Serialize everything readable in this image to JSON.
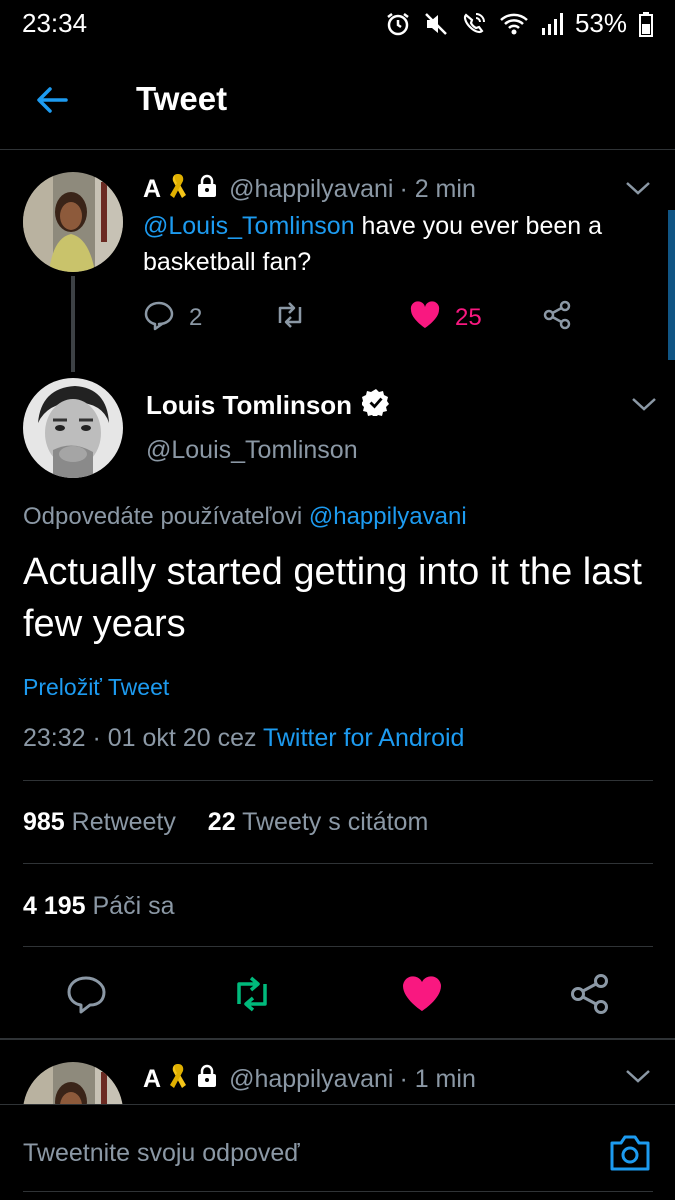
{
  "status_bar": {
    "time": "23:34",
    "battery": "53%",
    "icons": [
      "alarm-icon",
      "mute-icon",
      "wifi-call-icon",
      "wifi-icon",
      "signal-icon",
      "battery-icon"
    ]
  },
  "header": {
    "title": "Tweet",
    "back_icon": "arrow-left-icon"
  },
  "tweet_parent": {
    "name": "A",
    "handle": "@happilyavani",
    "time": "· 2 min",
    "mention": "@Louis_Tomlinson",
    "text": " have you ever been a basketball fan?",
    "replies": "2",
    "likes": "25"
  },
  "main_tweet": {
    "author_name": "Louis Tomlinson",
    "author_handle": "@Louis_Tomlinson",
    "reply_prefix": "Odpovedáte používateľovi ",
    "reply_to": "@happilyavani",
    "text": "Actually started getting into it the last few years",
    "translate_label": "Preložiť Tweet",
    "timestamp": "23:32 · 01 okt 20 cez ",
    "source": "Twitter for Android",
    "retweets_count": "985",
    "retweets_label": " Retweety",
    "quotes_count": "22",
    "quotes_label": " Tweety s citátom",
    "likes_count": "4 195",
    "likes_label": " Páči sa"
  },
  "tweet_reply": {
    "name": "A",
    "handle": "@happilyavani",
    "time": "· 1 min"
  },
  "composer": {
    "placeholder": "Tweetnite svoju odpoveď"
  },
  "colors": {
    "accent": "#1d9bf0",
    "like": "#f91880",
    "retweet": "#00ba7c",
    "ribbon": "#f5c518",
    "muted": "#8b98a5",
    "background": "#000000"
  }
}
